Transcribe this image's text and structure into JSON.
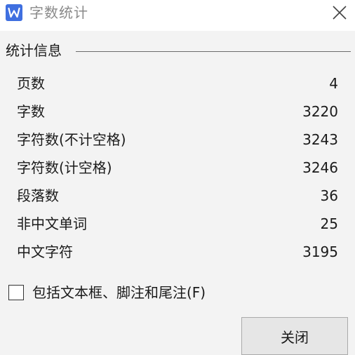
{
  "window": {
    "title": "字数统计",
    "app_icon_letter": "W",
    "app_icon_color": "#3f6fe0",
    "close_icon": "close-icon"
  },
  "group": {
    "header": "统计信息"
  },
  "stats": [
    {
      "label": "页数",
      "value": "4"
    },
    {
      "label": "字数",
      "value": "3220"
    },
    {
      "label": "字符数(不计空格)",
      "value": "3243"
    },
    {
      "label": "字符数(计空格)",
      "value": "3246"
    },
    {
      "label": "段落数",
      "value": "36"
    },
    {
      "label": "非中文单词",
      "value": "25"
    },
    {
      "label": "中文字符",
      "value": "3195"
    }
  ],
  "checkbox": {
    "label": "包括文本框、脚注和尾注(F)",
    "checked": false
  },
  "buttons": {
    "close_label": "关闭"
  }
}
